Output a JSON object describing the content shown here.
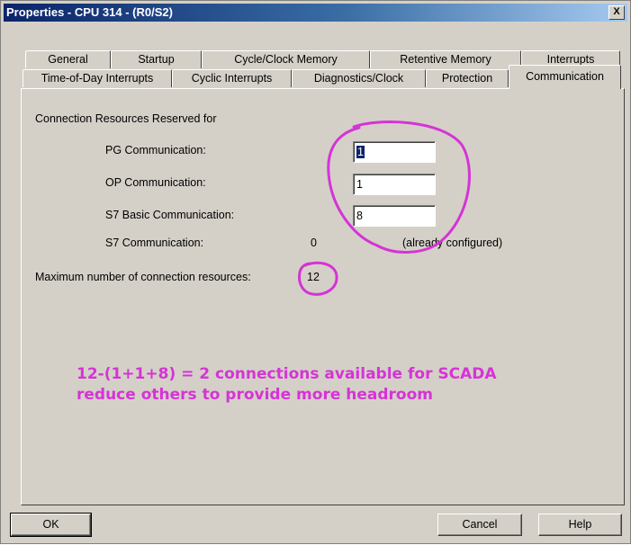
{
  "window": {
    "title": "Properties - CPU 314 - (R0/S2)",
    "close_label": "X"
  },
  "tabs_back": [
    "General",
    "Startup",
    "Cycle/Clock Memory",
    "Retentive Memory",
    "Interrupts"
  ],
  "tabs_front": [
    "Time-of-Day Interrupts",
    "Cyclic Interrupts",
    "Diagnostics/Clock",
    "Protection",
    "Communication"
  ],
  "active_tab": "Communication",
  "communication": {
    "section_label": "Connection Resources Reserved for",
    "pg_label": "PG Communication:",
    "pg_value": "1",
    "op_label": "OP Communication:",
    "op_value": "1",
    "s7basic_label": "S7 Basic Communication:",
    "s7basic_value": "8",
    "s7_label": "S7 Communication:",
    "s7_value": "0",
    "s7_note": "(already configured)",
    "max_label": "Maximum number of connection resources:",
    "max_value": "12"
  },
  "annotation": {
    "line1": "12-(1+1+8) = 2 connections available for SCADA",
    "line2": "reduce others to provide more headroom",
    "color": "#d633d6"
  },
  "buttons": {
    "ok": "OK",
    "cancel": "Cancel",
    "help": "Help"
  }
}
